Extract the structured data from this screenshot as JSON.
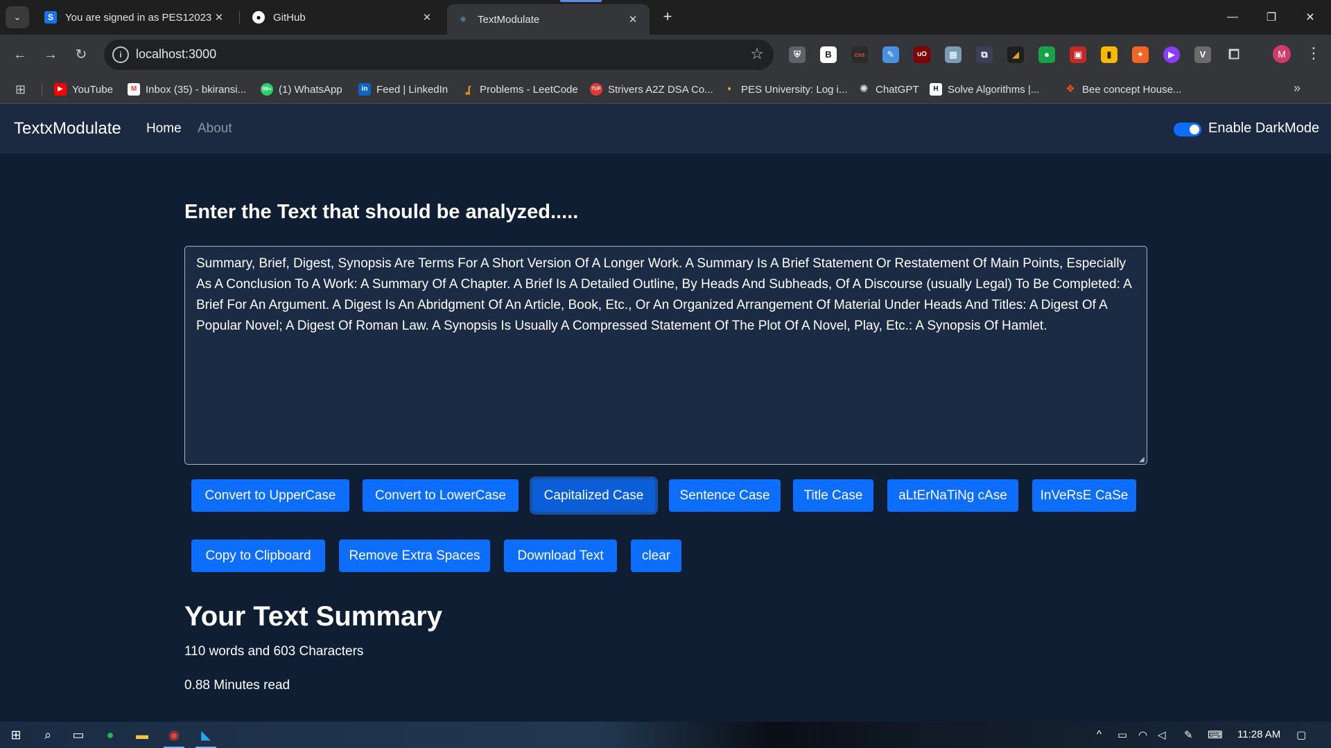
{
  "browser": {
    "tabs": [
      {
        "title": "You are signed in as PES12023",
        "favicon": "S",
        "active": false
      },
      {
        "title": "GitHub",
        "favicon": "github",
        "active": false
      },
      {
        "title": "TextModulate",
        "favicon": "react",
        "active": true
      }
    ],
    "address": "localhost:3000",
    "bookmarks": [
      {
        "label": "YouTube",
        "icon": "youtube-icon",
        "color": "#ff0000"
      },
      {
        "label": "Inbox (35) - bkiransi...",
        "icon": "gmail-icon",
        "color": "#ea4335"
      },
      {
        "label": "(1) WhatsApp",
        "icon": "whatsapp-icon",
        "color": "#25d366"
      },
      {
        "label": "Feed | LinkedIn",
        "icon": "linkedin-icon",
        "color": "#0a66c2"
      },
      {
        "label": "Problems - LeetCode",
        "icon": "leetcode-icon",
        "color": "#ffa116"
      },
      {
        "label": "Strivers A2Z DSA Co...",
        "icon": "tuf-icon",
        "color": "#e53935"
      },
      {
        "label": "PES University: Log i...",
        "icon": "pes-icon",
        "color": "#f4b400"
      },
      {
        "label": "ChatGPT",
        "icon": "chatgpt-icon",
        "color": "#e0e0e0"
      },
      {
        "label": "Solve Algorithms |...",
        "icon": "hackerrank-icon",
        "color": "#2ec866"
      },
      {
        "label": "Bee concept House...",
        "icon": "figma-icon",
        "color": "#f24e1e"
      }
    ],
    "profile_initial": "M"
  },
  "app": {
    "brand": "TextxModulate",
    "nav": {
      "home": "Home",
      "about": "About"
    },
    "dark_mode_label": "Enable DarkMode",
    "dark_mode_on": true,
    "heading": "Enter the Text that should be analyzed.....",
    "text_value": "Summary, Brief, Digest, Synopsis Are Terms For A Short Version Of A Longer Work. A Summary Is A Brief Statement Or Restatement Of Main Points, Especially As A Conclusion To A Work: A Summary Of A Chapter. A Brief Is A Detailed Outline, By Heads And Subheads, Of A Discourse (usually Legal) To Be Completed: A Brief For An Argument. A Digest Is An Abridgment Of An Article, Book, Etc., Or An Organized Arrangement Of Material Under Heads And Titles: A Digest Of A Popular Novel; A Digest Of Roman Law. A Synopsis Is Usually A Compressed Statement Of The Plot Of A Novel, Play, Etc.: A Synopsis Of Hamlet.",
    "buttons_row1": [
      "Convert to UpperCase",
      "Convert to LowerCase",
      "Capitalized Case",
      "Sentence Case",
      "Title Case",
      "aLtErNaTiNg cAse",
      "InVeRsE CaSe"
    ],
    "buttons_row2": [
      "Copy to Clipboard",
      "Remove Extra Spaces",
      "Download Text",
      "clear"
    ],
    "summary_title": "Your Text Summary",
    "summary_count": "110 words and 603 Characters",
    "summary_read": "0.88 Minutes read",
    "accent_color": "#0d6efd"
  },
  "taskbar": {
    "time": "11:28 AM"
  }
}
